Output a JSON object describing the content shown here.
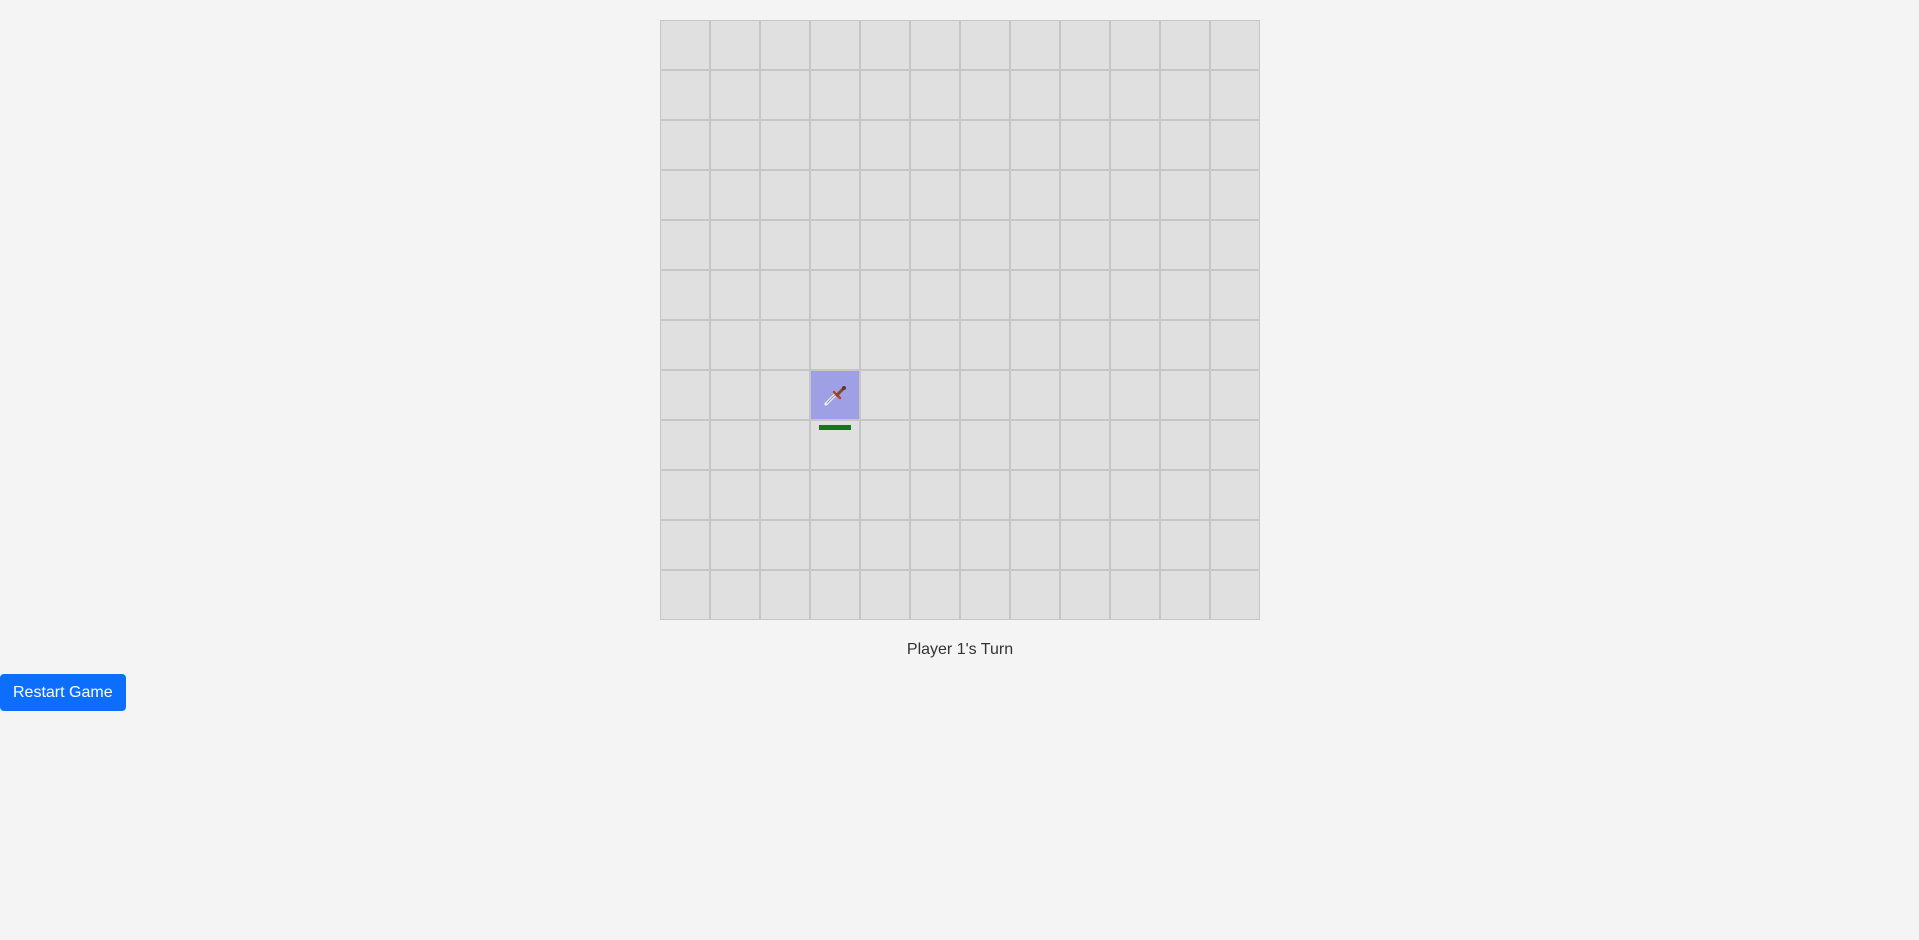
{
  "board": {
    "rows": 12,
    "cols": 12,
    "units": [
      {
        "row": 7,
        "col": 3,
        "icon": "sword-icon",
        "highlight": true,
        "health": 1.0,
        "health_color": "#137a13"
      }
    ]
  },
  "colors": {
    "cell": "#e0e0e0",
    "cell_border": "#c6c6c6",
    "highlight": "#9f9fe6",
    "button": "#0d6efd"
  },
  "status": {
    "turn_text": "Player 1's Turn"
  },
  "controls": {
    "restart_label": "Restart Game"
  }
}
